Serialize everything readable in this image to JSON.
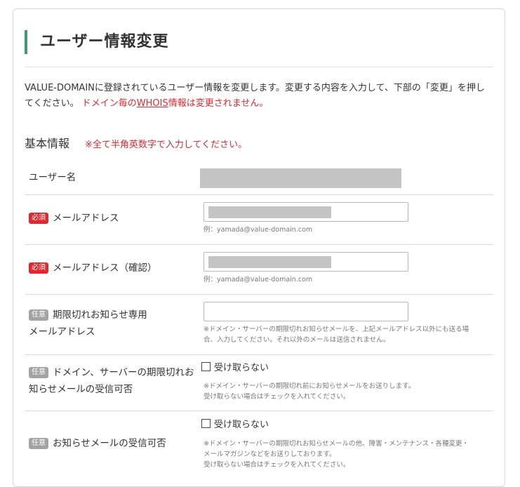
{
  "page": {
    "title": "ユーザー情報変更",
    "intro_text": "VALUE-DOMAINに登録されているユーザー情報を変更します。変更する内容を入力して、下部の「変更」を押してください。",
    "intro_warn_prefix": "ドメイン毎の",
    "intro_warn_link": "WHOIS",
    "intro_warn_suffix": "情報は変更されません。"
  },
  "section": {
    "heading": "基本情報",
    "note": "※全て半角英数字で入力してください。"
  },
  "badges": {
    "required": "必須",
    "optional": "任意"
  },
  "fields": {
    "username": {
      "label": "ユーザー名"
    },
    "email": {
      "label": "メールアドレス",
      "help": "例：yamada@value-domain.com"
    },
    "email_confirm": {
      "label": "メールアドレス（確認）",
      "help": "例：yamada@value-domain.com"
    },
    "expiry_email": {
      "label_line1": "期限切れお知らせ専用",
      "label_line2": "メールアドレス",
      "help_line1": "※ドメイン・サーバーの期限切れお知らせメールを、上記メールアドレス以外にも送る場",
      "help_line2": "合、入力してください。それ以外のメールは送信されません。"
    },
    "expiry_notice": {
      "label_line1": "ドメイン、サーバーの期限切れお",
      "label_line2": "知らせメールの受信可否",
      "checkbox_label": "受け取らない",
      "help_line1": "※ドメイン・サーバーの期限切れ前にお知らせメールをお送りします。",
      "help_line2": "受け取らない場合はチェックを入れてください。"
    },
    "notice_mail": {
      "label": "お知らせメールの受信可否",
      "checkbox_label": "受け取らない",
      "help_line1": "※ドメイン・サーバーの期限切れお知らせメールの他、障害・メンテナンス・各種変更・",
      "help_line2": "メールマガジンなどをお送りしております。",
      "help_line3": "受け取らない場合はチェックを入れてください。"
    }
  }
}
